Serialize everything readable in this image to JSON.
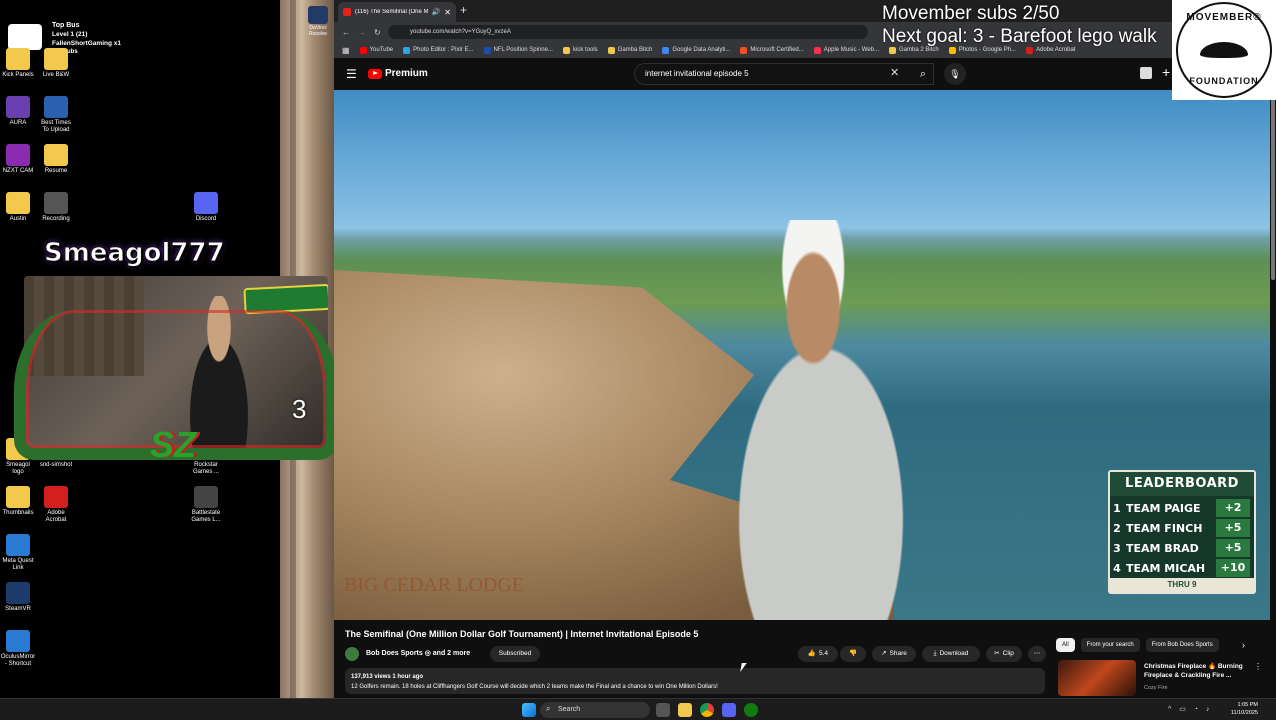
{
  "desktop": {
    "icons": [
      {
        "label": "Kick Panels",
        "color": "#f2c94c"
      },
      {
        "label": "Live B&W",
        "color": "#f2c94c"
      },
      {
        "label": "AURA",
        "color": "#6a3fb0"
      },
      {
        "label": "Best Times\nTo Upload",
        "color": "#2b5fb0"
      },
      {
        "label": "NZXT CAM",
        "color": "#8a2bb0"
      },
      {
        "label": "Resume",
        "color": "#f2c94c"
      },
      {
        "label": "Austin",
        "color": "#f2c94c"
      },
      {
        "label": "Recording",
        "color": "#555"
      },
      {
        "label": "Discord",
        "color": "#5865f2"
      },
      {
        "label": "Smeagol\nlogo",
        "color": "#f2c94c"
      },
      {
        "label": "snd-simshot",
        "color": "#555"
      },
      {
        "label": "Rockstar\nGames ...",
        "color": "#e8a20f"
      },
      {
        "label": "Thumbnails",
        "color": "#f2c94c"
      },
      {
        "label": "Adobe\nAcrobat",
        "color": "#d4201c"
      },
      {
        "label": "Battlestate\nGames L...",
        "color": "#444"
      },
      {
        "label": "Meta Quest\nLink",
        "color": "#2a7ad4"
      },
      {
        "label": "SteamVR",
        "color": "#1b3c6b"
      },
      {
        "label": "OculusMirror\n- Shortcut",
        "color": "#2a7ad4"
      }
    ],
    "top_text": {
      "line1": "Top Bus",
      "line2": "Level 1  (21)",
      "line3": "FallenShortGaming x1",
      "line4": "2 Subs"
    },
    "deco_label": "DaVinci\nResolve"
  },
  "overlay": {
    "streamer_name": "Smeagol777",
    "cam_counter": "3",
    "movember_line1": "Movember subs 2/50",
    "movember_line2": "Next goal: 3 - Barefoot lego walk",
    "movember_logo_top": "MOVEMBER®",
    "movember_logo_bottom": "FOUNDATION"
  },
  "browser": {
    "tab_title": "(116) The Semifinal (One M",
    "url": "youtube.com/watch?v=YGuyQ_xvzeA",
    "bookmarks": [
      {
        "label": "YouTube",
        "color": "#ff0000"
      },
      {
        "label": "Photo Editor : Pixlr E...",
        "color": "#2aa8e0"
      },
      {
        "label": "NFL Position Spinne...",
        "color": "#1a4fb0"
      },
      {
        "label": "kick tools",
        "color": "#f2c94c"
      },
      {
        "label": "Gamba Bitch",
        "color": "#f2c94c"
      },
      {
        "label": "Google Data Analyti...",
        "color": "#4285f4"
      },
      {
        "label": "Microsoft Certified...",
        "color": "#f25022"
      },
      {
        "label": "Apple Music - Web...",
        "color": "#fa2d55"
      },
      {
        "label": "Gamba 2 Bitch",
        "color": "#f2c94c"
      },
      {
        "label": "Photos - Google Ph...",
        "color": "#fbbc05"
      },
      {
        "label": "Adobe Acrobat",
        "color": "#d4201c"
      }
    ]
  },
  "youtube": {
    "logo_label": "Premium",
    "search_value": "internet invitational episode 5",
    "video": {
      "watermark": "BIG CEDAR LODGE",
      "leaderboard": {
        "title": "LEADERBOARD",
        "rows": [
          {
            "rank": "1",
            "team": "TEAM PAIGE",
            "score": "+2"
          },
          {
            "rank": "2",
            "team": "TEAM FINCH",
            "score": "+5"
          },
          {
            "rank": "3",
            "team": "TEAM BRAD",
            "score": "+5"
          },
          {
            "rank": "4",
            "team": "TEAM MICAH",
            "score": "+10"
          }
        ],
        "footer": "THRU 9"
      }
    },
    "title": "The Semifinal (One Million Dollar Golf Tournament) | Internet Invitational Episode 5",
    "channel": "Bob Does Sports ◎ and 2 more",
    "subscribe_label": "Subscribed",
    "likes": "5.4",
    "share_label": "Share",
    "download_label": "Download",
    "clip_label": "Clip",
    "description_meta": "137,913 views  1 hour ago",
    "description_text": "12 Golfers remain. 18 holes at Cliffhangers Golf Course will decide which 2 teams make the Final and a chance to win One Million Dollars!",
    "chips": [
      {
        "label": "All",
        "active": true
      },
      {
        "label": "From your search",
        "active": false
      },
      {
        "label": "From Bob Does Sports",
        "active": false
      }
    ],
    "recommended": {
      "title": "Christmas Fireplace 🔥 Burning Fireplace & Crackling Fire ...",
      "channel": "Cozy Fire"
    }
  },
  "taskbar": {
    "search_placeholder": "Search",
    "time": "1:05 PM",
    "date": "11/10/2025"
  }
}
